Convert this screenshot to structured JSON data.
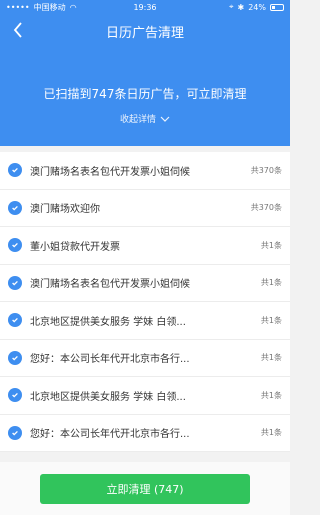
{
  "status_bar": {
    "carrier": "中国移动",
    "time": "19:36",
    "battery": "24%"
  },
  "nav": {
    "back_icon": "chevron-left-icon",
    "title": "日历广告清理"
  },
  "summary": {
    "scan_text": "已扫描到747条日历广告，可立即清理",
    "collapse_label": "收起详情"
  },
  "items": [
    {
      "text": "澳门赌场名表名包代开发票小姐伺候",
      "count": "共370条"
    },
    {
      "text": "澳门赌场欢迎你",
      "count": "共370条"
    },
    {
      "text": "董小姐贷款代开发票",
      "count": "共1条"
    },
    {
      "text": "澳门赌场名表名包代开发票小姐伺候",
      "count": "共1条"
    },
    {
      "text": "北京地区提供美女服务 学妹 白领...",
      "count": "共1条"
    },
    {
      "text": "您好：本公司长年代开北京市各行...",
      "count": "共1条"
    },
    {
      "text": "北京地区提供美女服务 学妹 白领...",
      "count": "共1条"
    },
    {
      "text": "您好：本公司长年代开北京市各行...",
      "count": "共1条"
    }
  ],
  "action": {
    "clean_label": "立即清理 (747)"
  },
  "colors": {
    "primary": "#3e8ef0",
    "button": "#31c45c"
  }
}
